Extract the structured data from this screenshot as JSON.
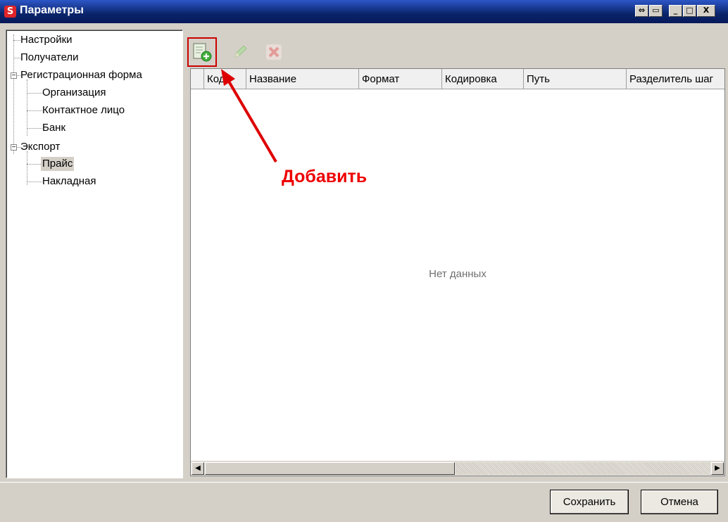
{
  "window": {
    "title": "Параметры"
  },
  "tree": [
    {
      "label": "Настройки"
    },
    {
      "label": "Получатели"
    },
    {
      "label": "Регистрационная форма"
    },
    {
      "label": "Организация"
    },
    {
      "label": "Контактное лицо"
    },
    {
      "label": "Банк"
    },
    {
      "label": "Экспорт"
    },
    {
      "label": "Прайс",
      "selected": true
    },
    {
      "label": "Накладная"
    }
  ],
  "toolbar": {
    "add_icon": "add-document-icon",
    "edit_icon": "pencil-icon",
    "delete_icon": "x-icon"
  },
  "grid": {
    "columns": [
      "Код",
      "Название",
      "Формат",
      "Кодировка",
      "Путь",
      "Разделитель шаг"
    ],
    "empty_text": "Нет данных"
  },
  "annotation": {
    "label": "Добавить",
    "color": "#e00000"
  },
  "buttons": {
    "save": "Сохранить",
    "cancel": "Отмена"
  }
}
